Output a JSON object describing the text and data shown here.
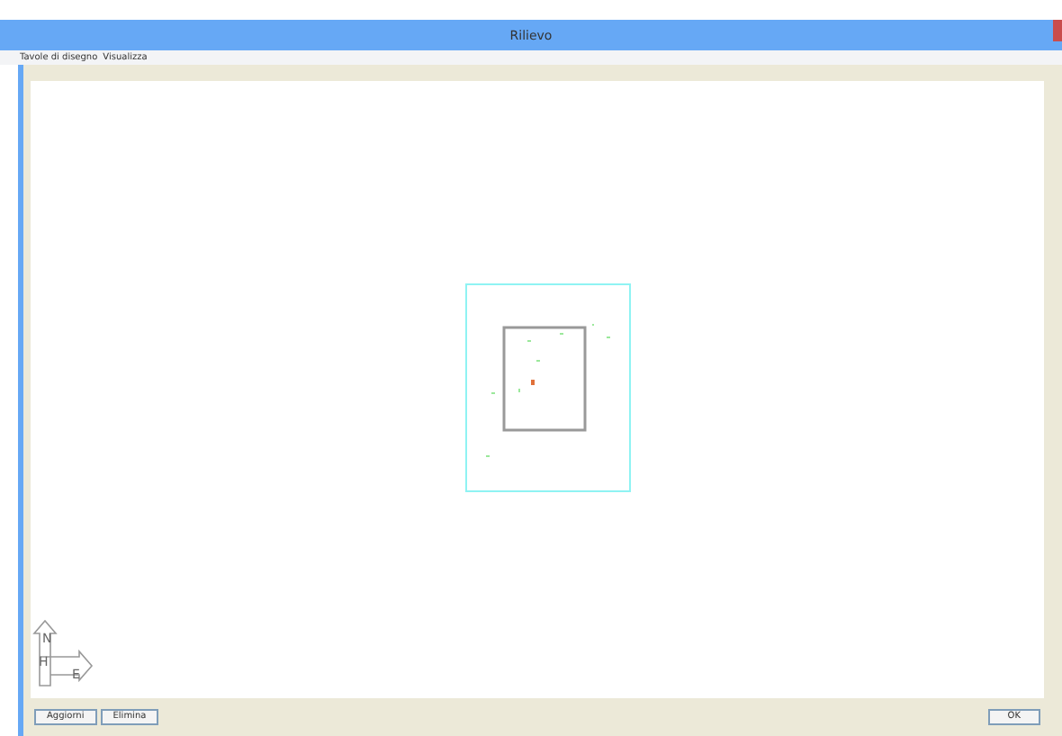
{
  "window": {
    "title": "Rilievo"
  },
  "menu": [
    "Tavole di disegno",
    "Visualizza"
  ],
  "compass": {
    "north": "N",
    "home": "H",
    "east": "E"
  },
  "buttons_left": [
    "Aggiorni",
    "Elimina"
  ],
  "button_right": "OK"
}
